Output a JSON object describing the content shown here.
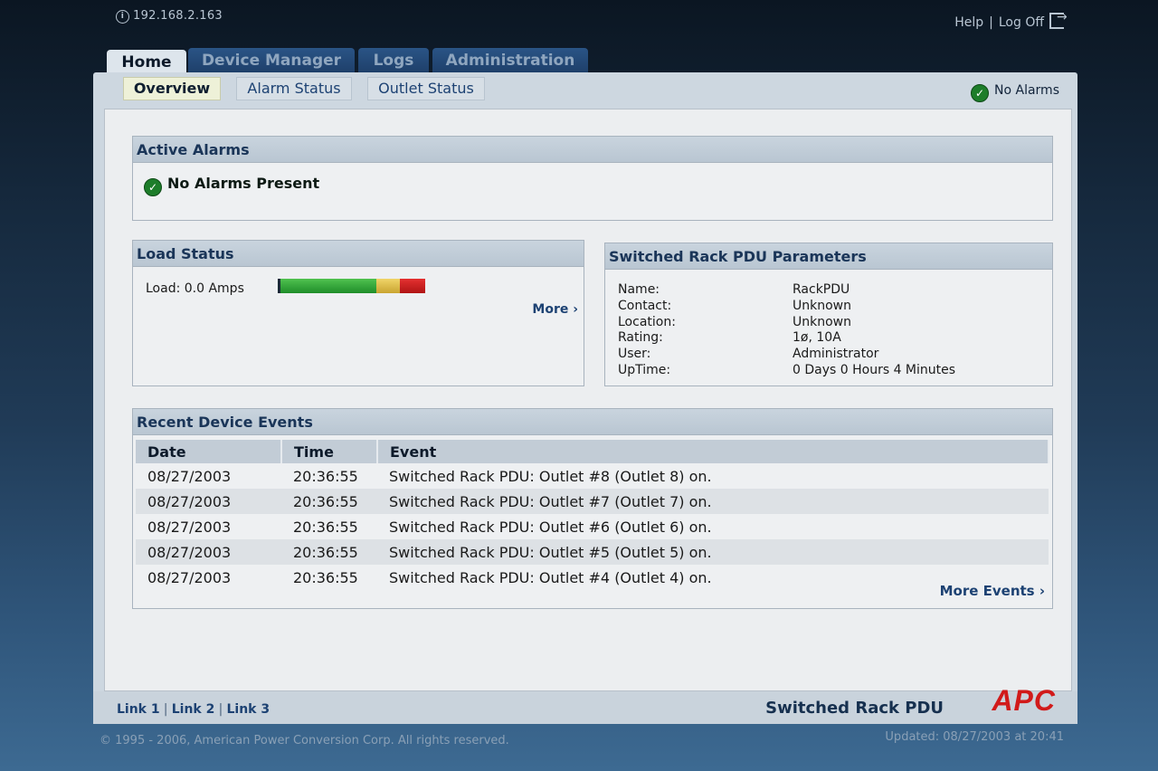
{
  "topbar": {
    "ip": "192.168.2.163",
    "help": "Help",
    "separator": "|",
    "logoff": "Log Off"
  },
  "tabs": [
    {
      "label": "Home",
      "active": true
    },
    {
      "label": "Device Manager",
      "active": false
    },
    {
      "label": "Logs",
      "active": false
    },
    {
      "label": "Administration",
      "active": false
    }
  ],
  "subtabs": [
    {
      "label": "Overview",
      "active": true
    },
    {
      "label": "Alarm Status",
      "active": false
    },
    {
      "label": "Outlet Status",
      "active": false
    }
  ],
  "status_indicator": "No Alarms",
  "active_alarms": {
    "title": "Active Alarms",
    "message": "No Alarms Present"
  },
  "load_status": {
    "title": "Load Status",
    "label": "Load: 0.0 Amps",
    "more": "More ›"
  },
  "pdu_params": {
    "title": "Switched Rack PDU Parameters",
    "rows": [
      {
        "key": "Name:",
        "value": "RackPDU"
      },
      {
        "key": "Contact:",
        "value": "Unknown"
      },
      {
        "key": "Location:",
        "value": "Unknown"
      },
      {
        "key": "Rating:",
        "value": "1ø, 10A"
      },
      {
        "key": "User:",
        "value": "Administrator"
      },
      {
        "key": "UpTime:",
        "value": "0 Days 0 Hours 4 Minutes"
      }
    ]
  },
  "events": {
    "title": "Recent Device Events",
    "columns": [
      "Date",
      "Time",
      "Event"
    ],
    "rows": [
      [
        "08/27/2003",
        "20:36:55",
        "Switched Rack PDU: Outlet #8 (Outlet 8) on."
      ],
      [
        "08/27/2003",
        "20:36:55",
        "Switched Rack PDU: Outlet #7 (Outlet 7) on."
      ],
      [
        "08/27/2003",
        "20:36:55",
        "Switched Rack PDU: Outlet #6 (Outlet 6) on."
      ],
      [
        "08/27/2003",
        "20:36:55",
        "Switched Rack PDU: Outlet #5 (Outlet 5) on."
      ],
      [
        "08/27/2003",
        "20:36:55",
        "Switched Rack PDU: Outlet #4 (Outlet 4) on."
      ]
    ],
    "more": "More Events ›"
  },
  "footer": {
    "links": [
      "Link 1",
      "Link 2",
      "Link 3"
    ],
    "link_separator": "|",
    "product": "Switched Rack PDU",
    "logo": "APC",
    "copyright": "© 1995 - 2006, American Power Conversion Corp. All rights reserved.",
    "updated": "Updated: 08/27/2003 at 20:41"
  },
  "colors": {
    "accent": "#1d4273",
    "logo_red": "#d11a1a",
    "ok_green": "#1d7d2a"
  }
}
